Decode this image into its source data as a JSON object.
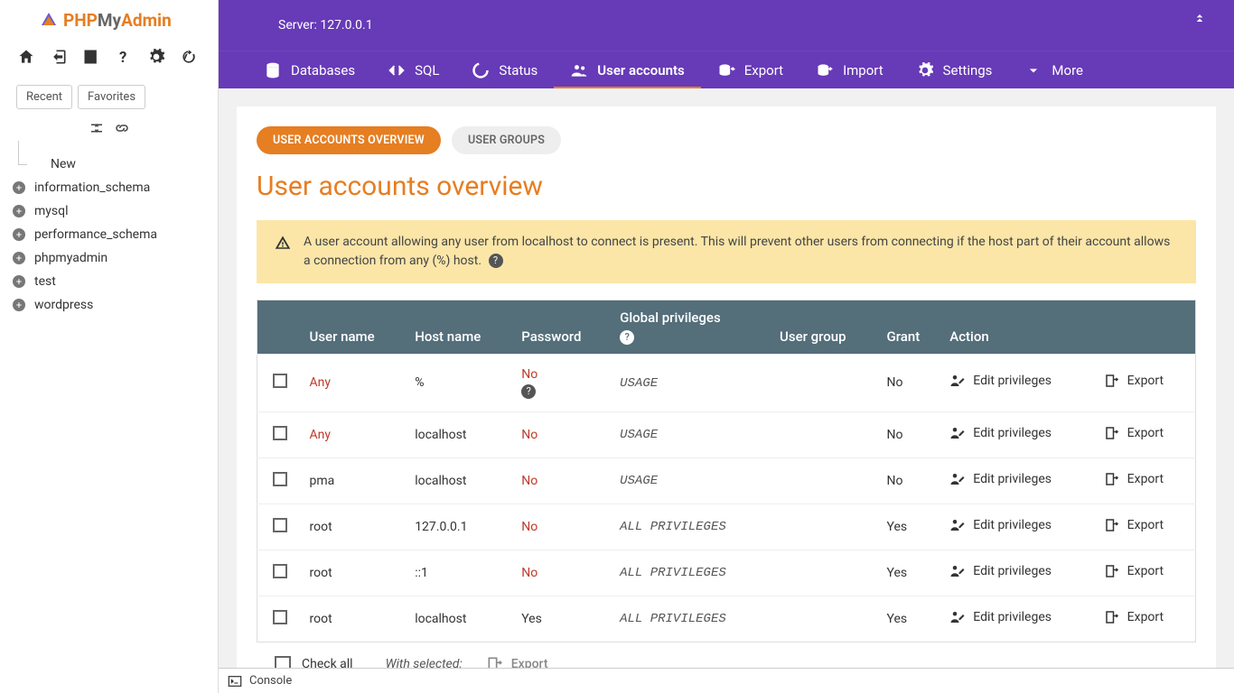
{
  "logo": {
    "php": "PHP",
    "my": "My",
    "admin": "Admin"
  },
  "server_label": "Server: 127.0.0.1",
  "nav_tabs": {
    "recent": "Recent",
    "favorites": "Favorites"
  },
  "db_new": "New",
  "databases": [
    "information_schema",
    "mysql",
    "performance_schema",
    "phpmyadmin",
    "test",
    "wordpress"
  ],
  "topmenu": {
    "databases": "Databases",
    "sql": "SQL",
    "status": "Status",
    "user_accounts": "User accounts",
    "export": "Export",
    "import": "Import",
    "settings": "Settings",
    "more": "More"
  },
  "subtabs": {
    "overview": "USER ACCOUNTS OVERVIEW",
    "groups": "USER GROUPS"
  },
  "heading": "User accounts overview",
  "notice_text": "A user account allowing any user from localhost to connect is present. This will prevent other users from connecting if the host part of their account allows a connection from any (%) host.",
  "table": {
    "headers": {
      "user": "User name",
      "host": "Host name",
      "password": "Password",
      "global_sub": "Global privileges",
      "usergroup": "User group",
      "grant": "Grant",
      "action": "Action"
    },
    "actions": {
      "edit": "Edit privileges",
      "export": "Export"
    },
    "rows": [
      {
        "user": "Any",
        "user_red": true,
        "host": "%",
        "password": "No",
        "password_red": true,
        "priv": "USAGE",
        "grant": "No",
        "has_help": true
      },
      {
        "user": "Any",
        "user_red": true,
        "host": "localhost",
        "password": "No",
        "password_red": true,
        "priv": "USAGE",
        "grant": "No"
      },
      {
        "user": "pma",
        "host": "localhost",
        "password": "No",
        "password_red": true,
        "priv": "USAGE",
        "grant": "No"
      },
      {
        "user": "root",
        "host": "127.0.0.1",
        "password": "No",
        "password_red": true,
        "priv": "ALL PRIVILEGES",
        "grant": "Yes"
      },
      {
        "user": "root",
        "host": "::1",
        "password": "No",
        "password_red": true,
        "priv": "ALL PRIVILEGES",
        "grant": "Yes"
      },
      {
        "user": "root",
        "host": "localhost",
        "password": "Yes",
        "password_red": false,
        "priv": "ALL PRIVILEGES",
        "grant": "Yes"
      }
    ]
  },
  "footer": {
    "check_all": "Check all",
    "with_selected": "With selected:",
    "export": "Export"
  },
  "console": "Console"
}
